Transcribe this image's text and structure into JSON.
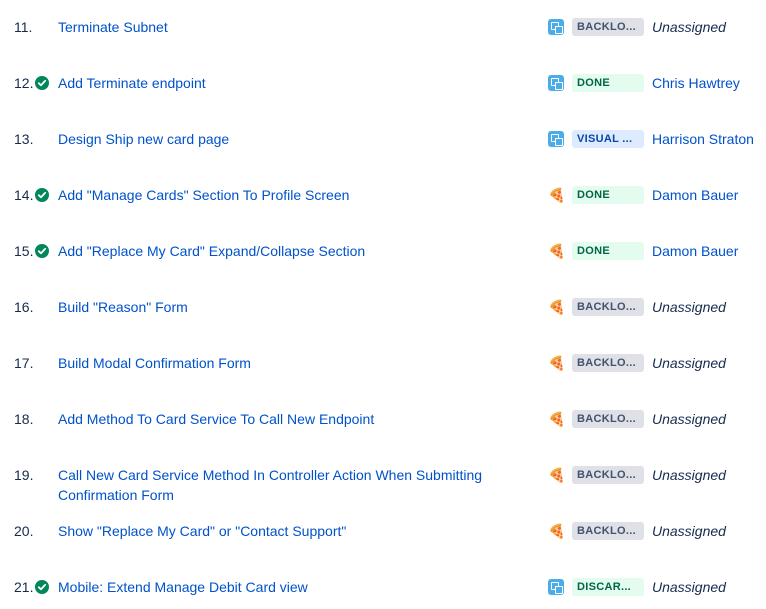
{
  "colors": {
    "link": "#0052cc",
    "done_green": "#00875a",
    "backlog_bg": "#dfe1e6",
    "done_bg": "#e3fcef",
    "visual_bg": "#deebff"
  },
  "issues": [
    {
      "number": "11.",
      "done": false,
      "title": "Terminate Subnet",
      "type_icon": "subtask-icon",
      "status": "BACKLO...",
      "status_kind": "backlog",
      "assignee": "Unassigned"
    },
    {
      "number": "12.",
      "done": true,
      "title": "Add Terminate endpoint",
      "type_icon": "subtask-icon",
      "status": "DONE",
      "status_kind": "done",
      "assignee": "Chris Hawtrey"
    },
    {
      "number": "13.",
      "done": false,
      "title": "Design Ship new card page",
      "type_icon": "subtask-icon",
      "status": "VISUAL ...",
      "status_kind": "visual",
      "assignee": "Harrison Straton"
    },
    {
      "number": "14.",
      "done": true,
      "title": "Add \"Manage Cards\" Section To Profile Screen",
      "type_icon": "pizza-icon",
      "status": "DONE",
      "status_kind": "done",
      "assignee": "Damon Bauer"
    },
    {
      "number": "15.",
      "done": true,
      "title": "Add \"Replace My Card\" Expand/Collapse Section",
      "type_icon": "pizza-icon",
      "status": "DONE",
      "status_kind": "done",
      "assignee": "Damon Bauer"
    },
    {
      "number": "16.",
      "done": false,
      "title": "Build \"Reason\" Form",
      "type_icon": "pizza-icon",
      "status": "BACKLO...",
      "status_kind": "backlog",
      "assignee": "Unassigned"
    },
    {
      "number": "17.",
      "done": false,
      "title": "Build Modal Confirmation Form",
      "type_icon": "pizza-icon",
      "status": "BACKLO...",
      "status_kind": "backlog",
      "assignee": "Unassigned"
    },
    {
      "number": "18.",
      "done": false,
      "title": "Add Method To Card Service To Call New Endpoint",
      "type_icon": "pizza-icon",
      "status": "BACKLO...",
      "status_kind": "backlog",
      "assignee": "Unassigned"
    },
    {
      "number": "19.",
      "done": false,
      "title": "Call New Card Service Method In Controller Action When Submitting Confirmation Form",
      "type_icon": "pizza-icon",
      "status": "BACKLO...",
      "status_kind": "backlog",
      "assignee": "Unassigned"
    },
    {
      "number": "20.",
      "done": false,
      "title": "Show \"Replace My Card\" or \"Contact Support\"",
      "type_icon": "pizza-icon",
      "status": "BACKLO...",
      "status_kind": "backlog",
      "assignee": "Unassigned"
    },
    {
      "number": "21.",
      "done": true,
      "title": "Mobile: Extend Manage Debit Card view",
      "type_icon": "subtask-icon",
      "status": "DISCAR...",
      "status_kind": "discarded",
      "assignee": "Unassigned"
    }
  ]
}
